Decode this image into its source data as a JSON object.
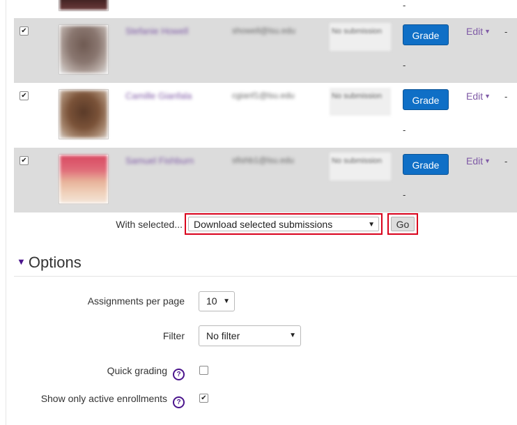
{
  "table": {
    "rows": [
      {
        "name": "Stefanie Howell",
        "email": "showell@lsu.edu",
        "status": "No submission",
        "grade_label": "Grade",
        "final_grade": "-",
        "edit_label": "Edit",
        "extra": "-",
        "checked": "✔"
      },
      {
        "name": "Camille Gianfala",
        "email": "cgianf1@lsu.edu",
        "status": "No submission",
        "grade_label": "Grade",
        "final_grade": "-",
        "edit_label": "Edit",
        "extra": "-",
        "checked": "✔"
      },
      {
        "name": "Samuel Fishburn",
        "email": "sfishb1@lsu.edu",
        "status": "No submission",
        "grade_label": "Grade",
        "final_grade": "-",
        "edit_label": "Edit",
        "extra": "-",
        "checked": "✔"
      }
    ],
    "top_row_final_grade": "-"
  },
  "bulk": {
    "label": "With selected...",
    "selected_action": "Download selected submissions",
    "go_label": "Go"
  },
  "options": {
    "heading": "Options",
    "assignments_per_page_label": "Assignments per page",
    "assignments_per_page_value": "10",
    "filter_label": "Filter",
    "filter_value": "No filter",
    "quick_grading_label": "Quick grading",
    "quick_grading_checked": false,
    "active_only_label": "Show only active enrollments",
    "active_only_checked": true,
    "checkmark": "✔"
  },
  "icons": {
    "dropdown_arrow": "▼",
    "edit_caret": "▼",
    "collapse": "▼",
    "help": "?"
  },
  "colors": {
    "accent": "#0f6fc6",
    "link": "#7f5aa6",
    "highlight_border": "#d9001b",
    "row_shade": "#dcdcdc"
  }
}
